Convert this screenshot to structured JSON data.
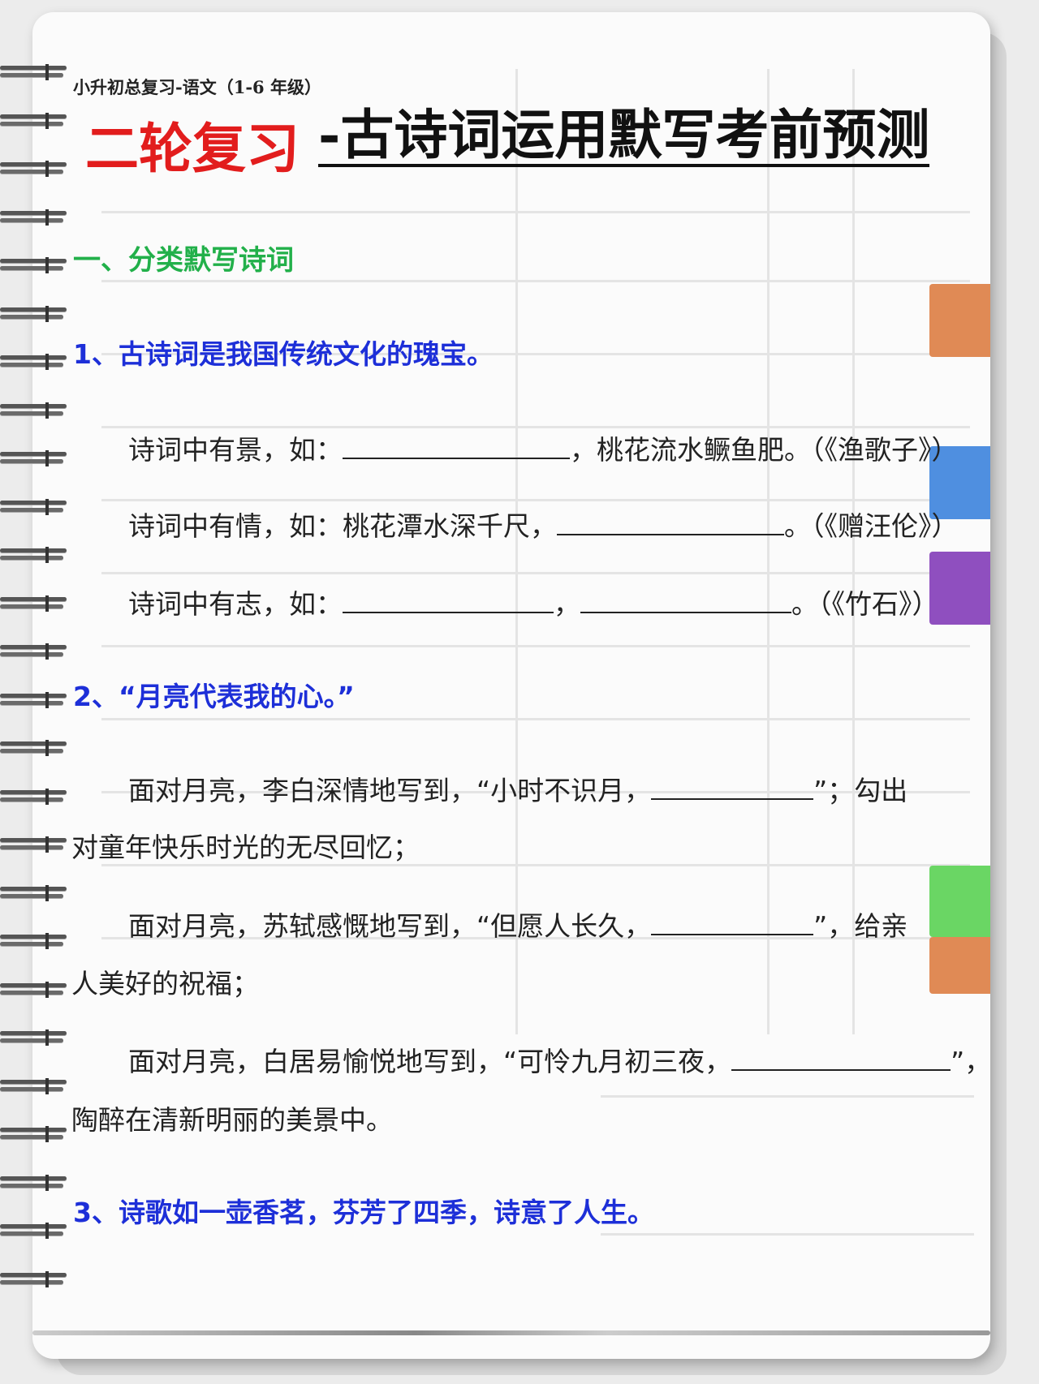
{
  "subtitle": "小升初总复习-语文（1-6 年级）",
  "title": {
    "red": "二轮复习",
    "black": "-古诗词运用默写考前预测"
  },
  "section_1": {
    "heading": "一、分类默写诗词"
  },
  "q1": {
    "heading": "1、古诗词是我国传统文化的瑰宝。",
    "line1": {
      "a": "诗词中有景，如：",
      "b": "，桃花流水鳜鱼肥。（《渔歌子》）"
    },
    "line2": {
      "a": "诗词中有情，如：桃花潭水深千尺，",
      "b": "。（《赠汪伦》）"
    },
    "line3": {
      "a": "诗词中有志，如：",
      "b": "，",
      "c": "。（《竹石》）"
    }
  },
  "q2": {
    "heading": "2、“月亮代表我的心。”",
    "p1": {
      "a": "面对月亮，李白深情地写到，“小时不识月，",
      "b": "”；勾出",
      "c": "对童年快乐时光的无尽回忆；"
    },
    "p2": {
      "a": "面对月亮，苏轼感慨地写到，“但愿人长久，",
      "b": "”，给亲",
      "c": "人美好的祝福；"
    },
    "p3": {
      "a": "面对月亮，白居易愉悦地写到，“可怜九月初三夜，",
      "b": "”，",
      "c": "陶醉在清新明丽的美景中。"
    }
  },
  "q3": {
    "heading": "3、诗歌如一壶香茗，芬芳了四季，诗意了人生。"
  },
  "colors": {
    "title_red": "#e21d1d",
    "section_green": "#22b04a",
    "question_blue": "#1d2fd8",
    "tab_orange": "#e08a55",
    "tab_blue": "#4f8fe0",
    "tab_purple": "#8f4fbf",
    "tab_green": "#6ad664"
  }
}
